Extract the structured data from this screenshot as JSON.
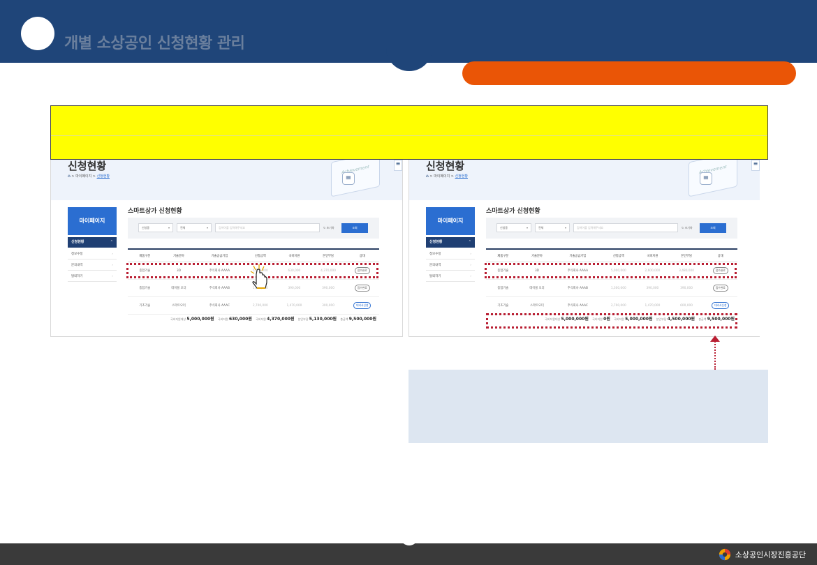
{
  "header": {
    "title": "개별 소상공인 신청현황 관리"
  },
  "page": {
    "title": "신청현황",
    "breadcrumb": [
      "마이페이지",
      "신청현황"
    ],
    "board_text": "Achievement",
    "menu_glyph": "≡",
    "edge_glyph": "≡"
  },
  "sidebar": {
    "heading": "마이페이지",
    "active_item": "신청현황",
    "items": [
      "정보수정",
      "문의내역",
      "탈퇴하기"
    ]
  },
  "section_title": "스마트상가 신청현황",
  "filters": {
    "select1": "신청중",
    "select2": "전체",
    "search_placeholder": "검색어를 입력해주세요",
    "reset_label": "초기화",
    "search_button": "조회"
  },
  "table": {
    "columns": [
      "제품구분",
      "기술분야",
      "기술공급기업",
      "신청금액",
      "국비지원",
      "본인부담",
      "상태"
    ],
    "left_rows": [
      [
        "종합기술",
        "3D",
        "주식회사 AAAA",
        "5,000,000",
        "630,000",
        "4,370,000",
        "접수완료"
      ],
      [
        "종합기술",
        "테이블 오더",
        "주식회사 AAAB",
        "1,300,000",
        "390,000",
        "390,000",
        "접수완료"
      ],
      [
        "기초기술",
        "스마트오더",
        "주식회사 AAAC",
        "2,700,000",
        "1,470,000",
        "300,000",
        "대비서신청"
      ]
    ],
    "right_rows": [
      [
        "종합기술",
        "3D",
        "주식회사 AAAA",
        "5,000,000",
        "2,600,000",
        "3,480,000",
        "접수완료"
      ],
      [
        "종합기술",
        "테이블 오더",
        "주식회사 AAAB",
        "1,300,000",
        "390,000",
        "390,000",
        "접수완료"
      ],
      [
        "기초기술",
        "스마트오더",
        "주식회사 AAAC",
        "2,700,000",
        "1,470,000",
        "600,000",
        "대비서신청"
      ]
    ]
  },
  "summary_left": {
    "items": [
      {
        "label": "국비지원대상",
        "value": "5,000,000원"
      },
      {
        "label": "국비지원",
        "value": "630,000원"
      },
      {
        "label": "국비지원",
        "value": "4,370,000원"
      },
      {
        "label": "본인부담",
        "value": "5,130,000원"
      },
      {
        "label": "총금액",
        "value": "9,500,000원"
      }
    ]
  },
  "summary_right": {
    "items": [
      {
        "label": "국비지원대상",
        "value": "5,000,000원"
      },
      {
        "label": "국비지원",
        "value": "0원"
      },
      {
        "label": "국비지원",
        "value": "5,000,000원"
      },
      {
        "label": "본인부담",
        "value": "4,500,000원"
      },
      {
        "label": "총금액",
        "value": "9,500,000원"
      }
    ]
  },
  "footer": {
    "org_name": "소상공인시장진흥공단"
  },
  "colors": {
    "header_bg": "#1f4579",
    "accent_orange": "#ea5506",
    "highlight_yellow": "#ffff00",
    "annotation_red": "#b91e32",
    "primary_blue": "#2b6ed1",
    "note_bg": "#dde6f1",
    "footer_bg": "#3a3a3a"
  }
}
